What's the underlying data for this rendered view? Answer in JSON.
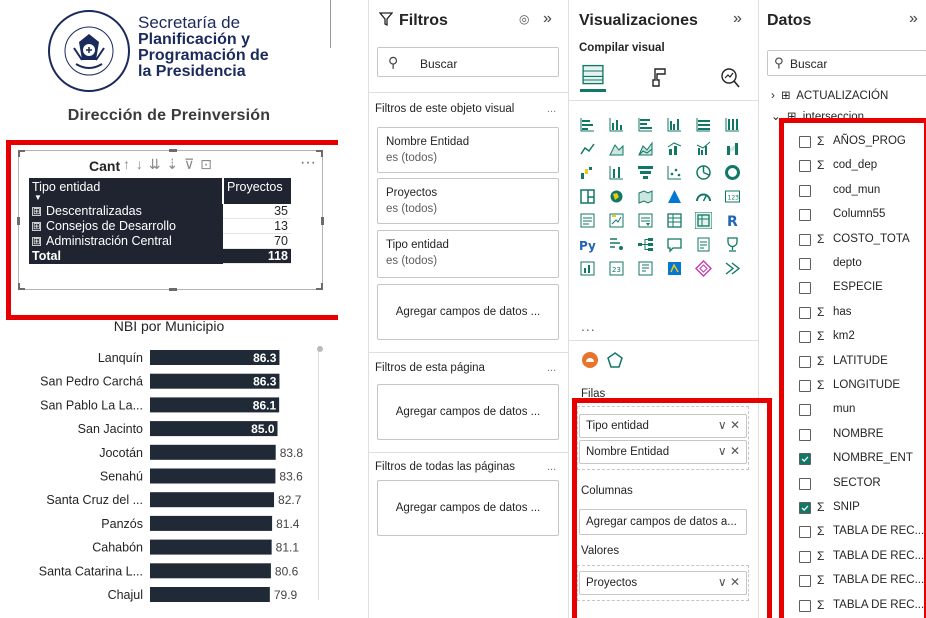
{
  "canvas": {
    "logo_lines": [
      "Secretaría de",
      "Planificación y",
      "Programación de",
      "la Presidencia"
    ],
    "seal_text_top": "GOBIERNO DE LA REPÚBLICA",
    "seal_text_bottom": "GUATEMALA",
    "report_title": "Dirección de Preinversión",
    "table_visual": {
      "title": "Cant",
      "header_icons": "↑ ↓ ⇊ ⇣ ⊽ ⊡",
      "more": "···",
      "columns": [
        "Tipo entidad",
        "Proyectos"
      ],
      "rows": [
        {
          "label": "Descentralizadas",
          "value": "35"
        },
        {
          "label": "Consejos de Desarrollo",
          "value": "13"
        },
        {
          "label": "Administración Central",
          "value": "70"
        }
      ],
      "total": {
        "label": "Total",
        "value": "118"
      },
      "expander": "⊞"
    },
    "nbi": {
      "title": "NBI por Municipio"
    }
  },
  "chart_data": {
    "type": "bar",
    "orientation": "horizontal",
    "title": "NBI por Municipio",
    "categories": [
      "Lanquín",
      "San Pedro Carchá",
      "San Pablo La La...",
      "San Jacinto",
      "Jocotán",
      "Senahú",
      "Santa Cruz del ...",
      "Panzós",
      "Cahabón",
      "Santa Catarina L...",
      "Chajul"
    ],
    "values": [
      86.3,
      86.3,
      86.1,
      85.0,
      83.8,
      83.6,
      82.7,
      81.4,
      81.1,
      80.6,
      79.9
    ],
    "labels": [
      "86.3",
      "86.3",
      "86.1",
      "85.0",
      "83.8",
      "83.6",
      "82.7",
      "81.4",
      "81.1",
      "80.6",
      "79.9"
    ],
    "xlim": [
      0,
      100
    ],
    "bar_color": "#1f2a36",
    "label_inside_count": 4
  },
  "filters": {
    "title": "Filtros",
    "collapse": "»",
    "eye": "◎",
    "search_placeholder": "Buscar",
    "visual_section": "Filtros de este objeto visual",
    "more": "...",
    "visual_filters": [
      {
        "name": "Nombre Entidad",
        "value": "es (todos)"
      },
      {
        "name": "Proyectos",
        "value": "es (todos)"
      },
      {
        "name": "Tipo entidad",
        "value": "es (todos)"
      }
    ],
    "add_fields": "Agregar campos de datos ...",
    "page_section": "Filtros de esta página",
    "all_pages_section": "Filtros de todas las páginas"
  },
  "viz": {
    "title": "Visualizaciones",
    "collapse": "»",
    "build_label": "Compilar visual",
    "more": "...",
    "filas_label": "Filas",
    "rows_fields": [
      "Tipo entidad",
      "Nombre Entidad"
    ],
    "field_actions": "∨ ✕",
    "columnas_label": "Columnas",
    "columnas_add": "Agregar campos de datos a...",
    "valores_label": "Valores",
    "values_fields": [
      "Proyectos"
    ]
  },
  "data_pane": {
    "title": "Datos",
    "collapse": "»",
    "search_placeholder": "Buscar",
    "tables": [
      "ACTUALIZACIÓN",
      "interseccion"
    ],
    "fields": [
      {
        "name": "AÑOS_PROG",
        "sigma": true,
        "checked": false
      },
      {
        "name": "cod_dep",
        "sigma": true,
        "checked": false
      },
      {
        "name": "cod_mun",
        "sigma": false,
        "checked": false
      },
      {
        "name": "Column55",
        "sigma": false,
        "checked": false
      },
      {
        "name": "COSTO_TOTA",
        "sigma": true,
        "checked": false
      },
      {
        "name": "depto",
        "sigma": false,
        "checked": false
      },
      {
        "name": "ESPECIE",
        "sigma": false,
        "checked": false
      },
      {
        "name": "has",
        "sigma": true,
        "checked": false
      },
      {
        "name": "km2",
        "sigma": true,
        "checked": false
      },
      {
        "name": "LATITUDE",
        "sigma": true,
        "checked": false
      },
      {
        "name": "LONGITUDE",
        "sigma": true,
        "checked": false
      },
      {
        "name": "mun",
        "sigma": false,
        "checked": false
      },
      {
        "name": "NOMBRE",
        "sigma": false,
        "checked": false
      },
      {
        "name": "NOMBRE_ENT",
        "sigma": false,
        "checked": true
      },
      {
        "name": "SECTOR",
        "sigma": false,
        "checked": false
      },
      {
        "name": "SNIP",
        "sigma": true,
        "checked": true
      },
      {
        "name": "TABLA DE REC...",
        "sigma": true,
        "checked": false
      },
      {
        "name": "TABLA DE REC...",
        "sigma": true,
        "checked": false
      },
      {
        "name": "TABLA DE REC...",
        "sigma": true,
        "checked": false
      },
      {
        "name": "TABLA DE REC...",
        "sigma": true,
        "checked": false
      }
    ],
    "sigma_symbol": "Σ",
    "check_symbol": "✓"
  },
  "colors": {
    "accent": "#117865",
    "highlight": "#e60000",
    "header_dark": "#1f2430"
  }
}
